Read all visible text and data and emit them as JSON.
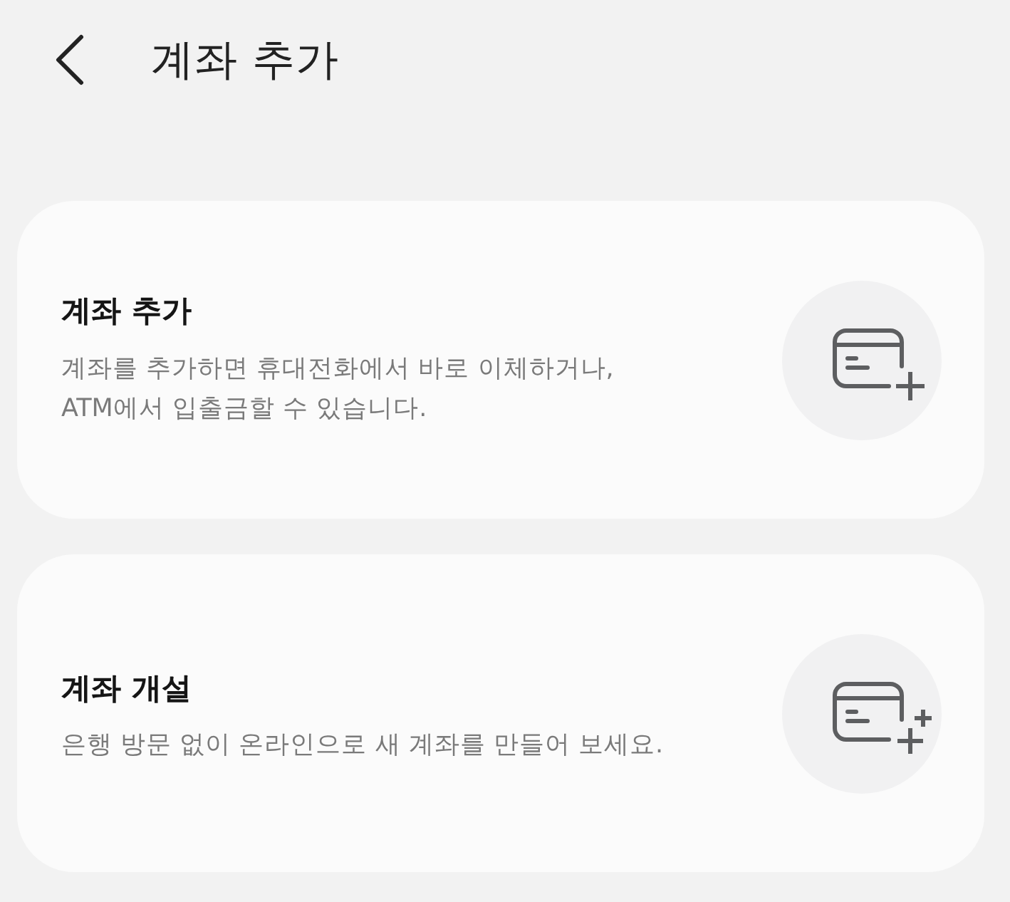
{
  "header": {
    "title": "계좌 추가"
  },
  "cards": [
    {
      "kind": "add",
      "title": "계좌 추가",
      "description": "계좌를 추가하면 휴대전화에서 바로 이체하거나,\nATM에서 입출금할 수 있습니다."
    },
    {
      "kind": "open",
      "title": "계좌 개설",
      "description": "은행 방문 없이 온라인으로 새 계좌를 만들어 보세요."
    }
  ]
}
